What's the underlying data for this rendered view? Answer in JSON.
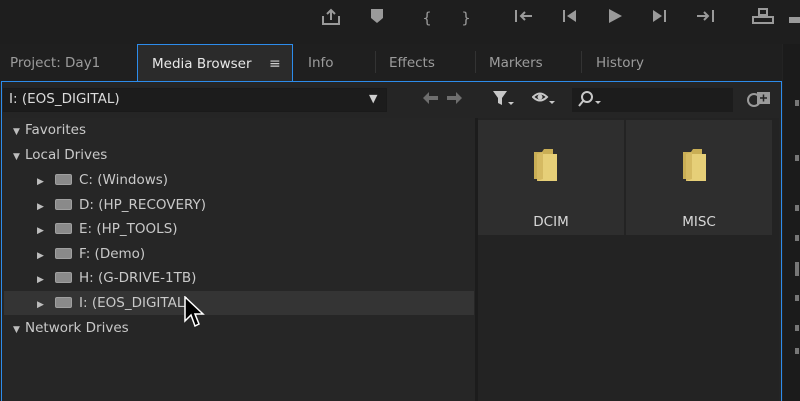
{
  "tabs": [
    {
      "label": "Project: Day1",
      "active": false
    },
    {
      "label": "Media Browser",
      "active": true,
      "menu_icon": "≡"
    },
    {
      "label": "Info",
      "active": false
    },
    {
      "label": "Effects",
      "active": false
    },
    {
      "label": "Markers",
      "active": false
    },
    {
      "label": "History",
      "active": false
    }
  ],
  "path_bar": {
    "current": "I: (EOS_DIGITAL)"
  },
  "tree": [
    {
      "label": "Favorites",
      "type": "section"
    },
    {
      "label": "Local Drives",
      "type": "section"
    },
    {
      "label": "C: (Windows)",
      "type": "drive"
    },
    {
      "label": "D: (HP_RECOVERY)",
      "type": "drive"
    },
    {
      "label": "E: (HP_TOOLS)",
      "type": "drive"
    },
    {
      "label": "F: (Demo)",
      "type": "drive"
    },
    {
      "label": "H: (G-DRIVE-1TB)",
      "type": "drive"
    },
    {
      "label": "I: (EOS_DIGITAL)",
      "type": "drive",
      "selected": true
    },
    {
      "label": "Network Drives",
      "type": "section"
    }
  ],
  "folders": [
    {
      "name": "DCIM"
    },
    {
      "name": "MISC"
    }
  ],
  "colors": {
    "accent": "#2d8ceb",
    "folder": "#e6cf78"
  }
}
